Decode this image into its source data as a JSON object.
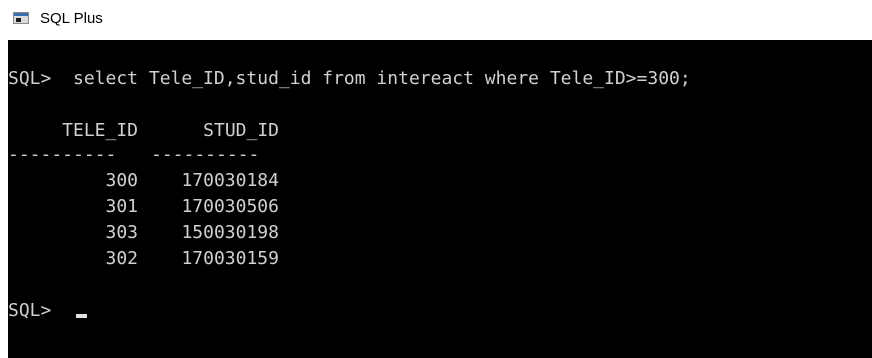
{
  "window": {
    "title": "SQL Plus"
  },
  "console": {
    "prompt": "SQL>",
    "command": "select Tele_ID,stud_id from intereact where Tele_ID>=300;",
    "headers": [
      "TELE_ID",
      "STUD_ID"
    ],
    "separators": [
      "----------",
      "----------"
    ],
    "rows": [
      [
        "300",
        "170030184"
      ],
      [
        "301",
        "170030506"
      ],
      [
        "303",
        "150030198"
      ],
      [
        "302",
        "170030159"
      ]
    ],
    "text_color": "#d0d0d0",
    "background_color": "#000000"
  },
  "icons": {
    "app": "sqlplus-window-icon",
    "cursor": "block-cursor"
  }
}
